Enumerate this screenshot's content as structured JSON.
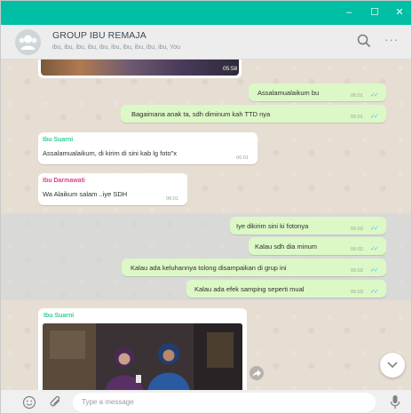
{
  "window": {
    "controls": {
      "minimize": "–",
      "maximize": "☐",
      "close": "✕"
    },
    "accent_color": "#00bfa5"
  },
  "header": {
    "title": "GROUP IBU REMAJA",
    "subtitle": "ibu, ibu, ibu, ibu, ibu, ibu, ibu, ibu, ibu, ibu, You",
    "icons": [
      "group-avatar-icon",
      "search-icon",
      "more-options-icon"
    ]
  },
  "messages": [
    {
      "type": "video",
      "direction": "in",
      "duration": "05:58"
    },
    {
      "type": "text",
      "direction": "out",
      "text": "Assalamualaikum bu",
      "time": "06:01",
      "status": "read"
    },
    {
      "type": "text",
      "direction": "out",
      "text": "Bagaimana anak ta, sdh diminum kah TTD nya",
      "time": "06:01",
      "status": "read"
    },
    {
      "type": "text",
      "direction": "in",
      "sender": "Ibu Suarni",
      "sender_color": "#35cd96",
      "text": "Assalamualaikum, di kirim di sini kab lg foto\"x",
      "time": "06:01"
    },
    {
      "type": "text",
      "direction": "in",
      "sender": "Ibu Darmawati",
      "sender_color": "#d8458f",
      "text": "Wa Alaikum salam ..iye SDH",
      "time": "06:01"
    },
    {
      "type": "text",
      "direction": "out",
      "text": "Iye dikirim sini ki fotonya",
      "time": "06:02",
      "status": "read"
    },
    {
      "type": "text",
      "direction": "out",
      "text": "Kalau sdh dia minum",
      "time": "06:02",
      "status": "read"
    },
    {
      "type": "text",
      "direction": "out",
      "text": "Kalau ada keluhannya tolong disampaikan di grup ini",
      "time": "06:02",
      "status": "read"
    },
    {
      "type": "text",
      "direction": "out",
      "text": "Kalau ada efek samping seperti mual",
      "time": "06:03",
      "status": "read"
    },
    {
      "type": "image",
      "direction": "in",
      "sender": "Ibu Suarni",
      "sender_color": "#35cd96"
    }
  ],
  "footer": {
    "placeholder": "Type a message",
    "icons": [
      "emoji-icon",
      "attach-icon",
      "microphone-icon"
    ]
  },
  "read_tick": "✓✓",
  "read_tick_color": "#4fc3f7"
}
